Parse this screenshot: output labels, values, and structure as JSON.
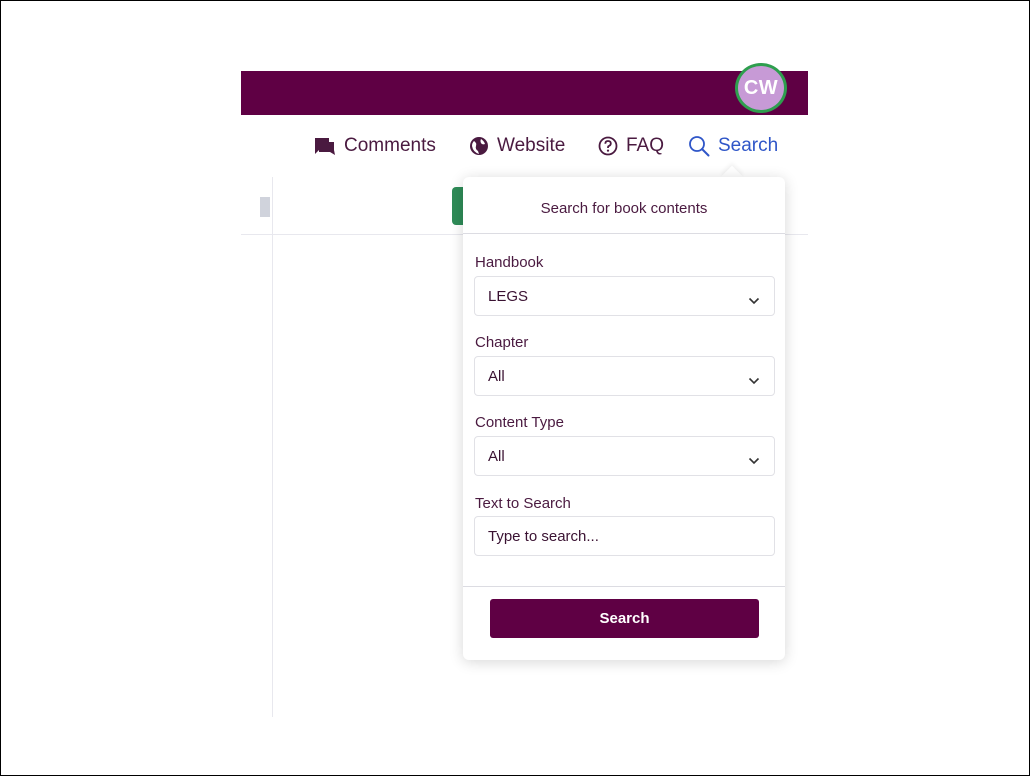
{
  "header": {
    "avatar_initials": "CW",
    "brand_color": "#5f0044",
    "avatar_ring_color": "#2e9e4e"
  },
  "nav": {
    "items": [
      {
        "label": "Comments",
        "icon": "comment-icon"
      },
      {
        "label": "Website",
        "icon": "globe-icon"
      },
      {
        "label": "FAQ",
        "icon": "help-circle-icon"
      },
      {
        "label": "Search",
        "icon": "search-icon",
        "active": true
      }
    ],
    "active_color": "#2f56c8"
  },
  "search_panel": {
    "title": "Search for book contents",
    "handbook": {
      "label": "Handbook",
      "value": "LEGS"
    },
    "chapter": {
      "label": "Chapter",
      "value": "All"
    },
    "content_type": {
      "label": "Content Type",
      "value": "All"
    },
    "text_to_search": {
      "label": "Text to Search",
      "placeholder": "Type to search..."
    },
    "submit_label": "Search"
  }
}
